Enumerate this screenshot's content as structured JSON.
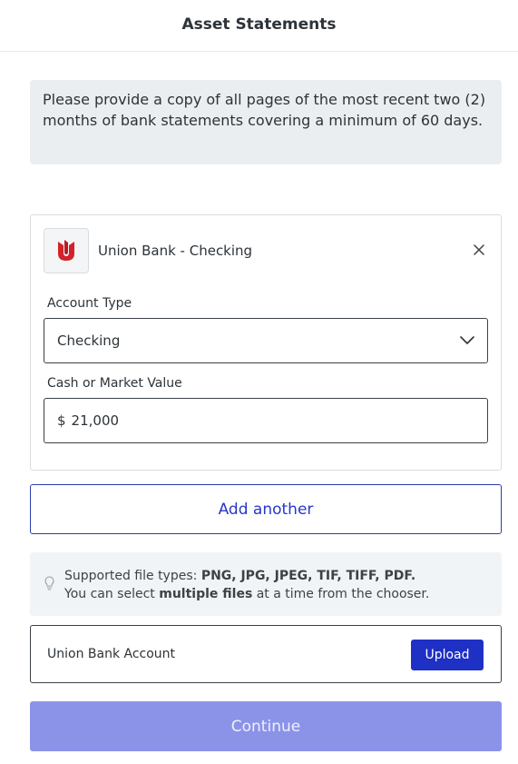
{
  "header": {
    "title": "Asset Statements"
  },
  "notice": {
    "text": "Please provide a copy of all pages of the most recent two (2) months of bank statements covering a minimum of 60 days."
  },
  "account_card": {
    "logo_icon": "union-bank-logo-icon",
    "bank_name": "Union Bank - Checking",
    "close_icon": "close-icon",
    "account_type_label": "Account Type",
    "account_type_value": "Checking",
    "value_label": "Cash or Market Value",
    "currency_symbol": "$",
    "value": "21,000"
  },
  "add_another_label": "Add another",
  "tip": {
    "icon": "lightbulb-icon",
    "line1_prefix": "Supported file types: ",
    "line1_types": "PNG, JPG, JPEG, TIF, TIFF, PDF.",
    "line2_prefix": "You can select ",
    "line2_bold": "multiple files",
    "line2_suffix": " at a time from the chooser."
  },
  "upload": {
    "label": "Union Bank Account",
    "button_label": "Upload"
  },
  "continue_label": "Continue",
  "colors": {
    "primary": "#1f30c4",
    "primary_disabled": "#8b93e8",
    "bank_red": "#d2232a",
    "notice_bg": "#ebeef0"
  }
}
